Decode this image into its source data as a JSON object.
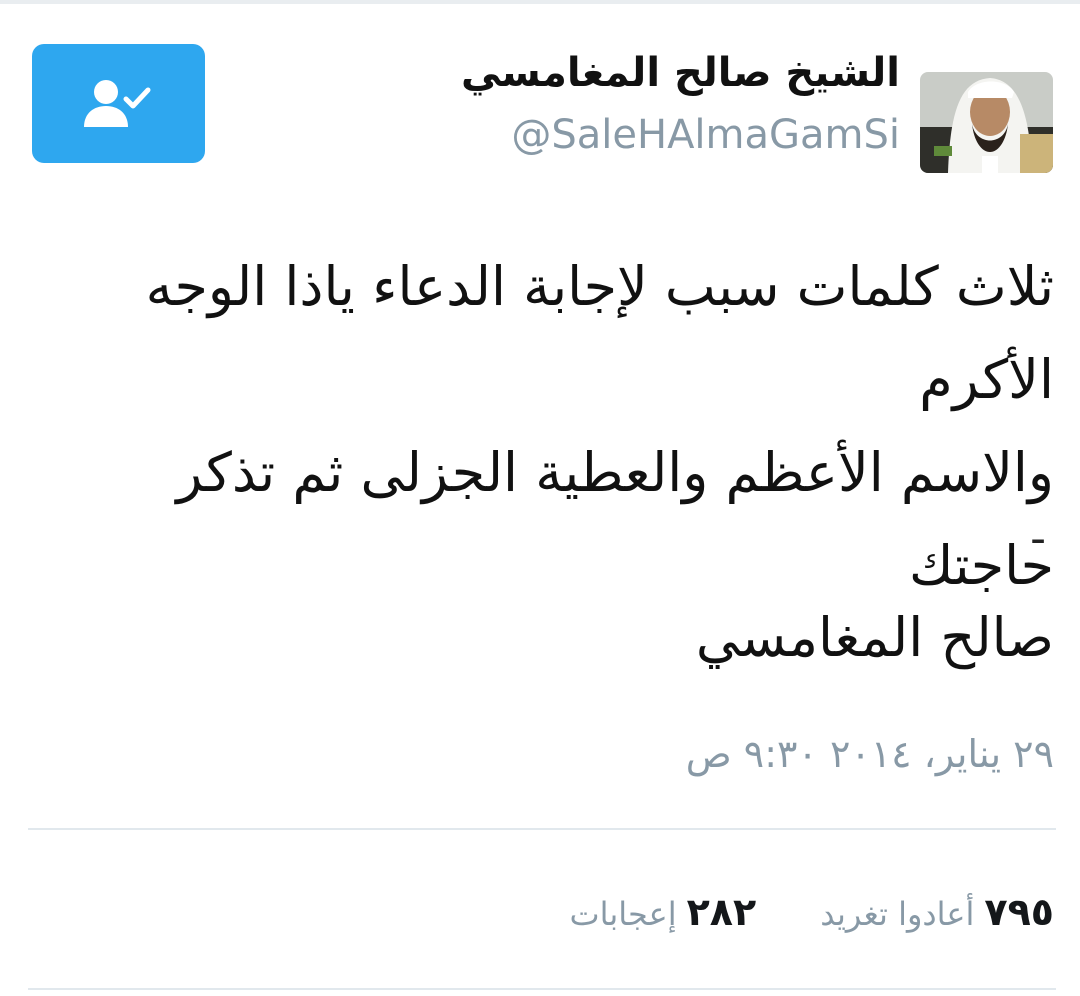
{
  "profile": {
    "display_name": "الشيخ صالح المغامسي",
    "handle": "@SaleHAlmaGamSi"
  },
  "follow_button": {
    "icon": "user-check-icon",
    "color": "#2ea7ef"
  },
  "tweet": {
    "line1": "ثلاث كلمات سبب لإجابة الدعاء ياذا الوجه الأكرم",
    "line2": "والاسم الأعظم والعطية الجزلى ثم تذكر حاجتك",
    "dash": "-",
    "signature": "صالح المغامسي",
    "timestamp": "٢٩ يناير، ٢٠١٤ ٩:٣٠ ص"
  },
  "stats": {
    "retweets_count": "٧٩٥",
    "retweets_label": "أعادوا تغريد",
    "likes_count": "٢٨٢",
    "likes_label": "إعجابات"
  }
}
